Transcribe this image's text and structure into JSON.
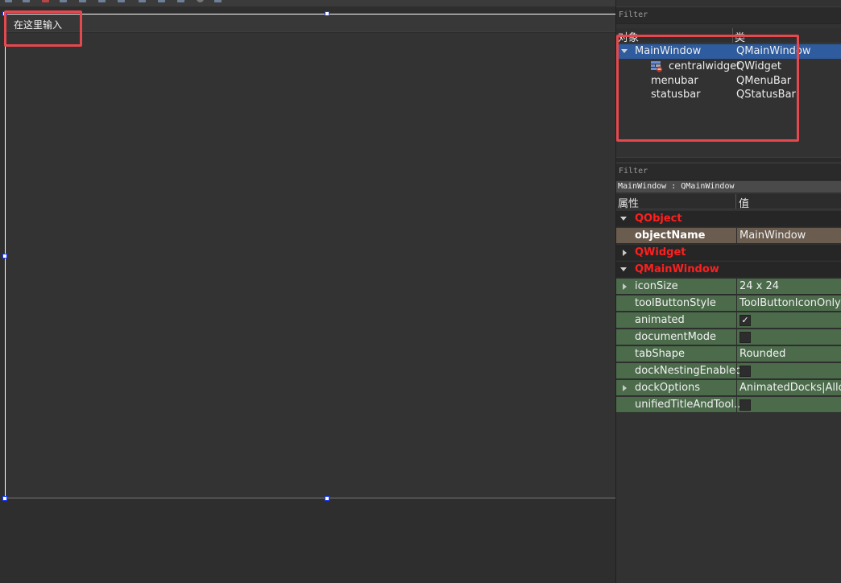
{
  "form": {
    "menubar_placeholder": "在这里输入"
  },
  "object_inspector": {
    "filter_placeholder": "Filter",
    "headers": {
      "object": "对象",
      "class": "类"
    },
    "rows": [
      {
        "name": "MainWindow",
        "class": "QMainWindow",
        "selected": true,
        "expanded": true
      },
      {
        "name": "centralwidget",
        "class": "QWidget",
        "icon": "layout-broken-icon"
      },
      {
        "name": "menubar",
        "class": "QMenuBar"
      },
      {
        "name": "statusbar",
        "class": "QStatusBar"
      }
    ]
  },
  "property_editor": {
    "filter_placeholder": "Filter",
    "class_line": "MainWindow : QMainWindow",
    "headers": {
      "property": "属性",
      "value": "值"
    },
    "rows": [
      {
        "name": "QObject",
        "kind": "group",
        "expanded": true
      },
      {
        "name": "objectName",
        "value": "MainWindow",
        "kind": "grey"
      },
      {
        "name": "QWidget",
        "kind": "group",
        "expanded": false
      },
      {
        "name": "QMainWindow",
        "kind": "group",
        "expanded": true
      },
      {
        "name": "iconSize",
        "value": "24 x 24",
        "kind": "green",
        "expandable": true
      },
      {
        "name": "toolButtonStyle",
        "value": "ToolButtonIconOnly",
        "kind": "green"
      },
      {
        "name": "animated",
        "checked": true,
        "kind": "green"
      },
      {
        "name": "documentMode",
        "checked": false,
        "kind": "green"
      },
      {
        "name": "tabShape",
        "value": "Rounded",
        "kind": "green"
      },
      {
        "name": "dockNestingEnabled",
        "checked": false,
        "kind": "green"
      },
      {
        "name": "dockOptions",
        "value": "AnimatedDocks|AllowT",
        "kind": "green",
        "expandable": true
      },
      {
        "name": "unifiedTitleAndTool...",
        "checked": false,
        "kind": "green"
      }
    ],
    "check_glyph": "✓"
  },
  "colors": {
    "selection": "#2e5c9e",
    "group_text": "#ff1f1f",
    "property_changed": "#4b6b4b",
    "highlight_box": "#e5484d"
  }
}
